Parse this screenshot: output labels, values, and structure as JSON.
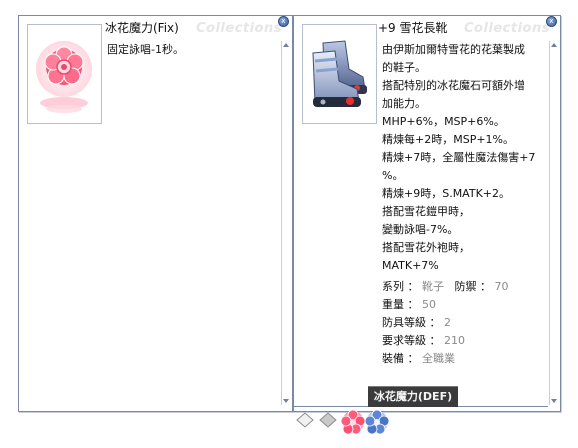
{
  "left_window": {
    "title": "冰花魔力(Fix)",
    "watermark": "Collections",
    "description": [
      "固定詠唱-1秒。"
    ]
  },
  "right_window": {
    "title": "+9 雪花長靴",
    "watermark": "Collections",
    "description": [
      "由伊斯加爾特雪花的花葉製成",
      "的鞋子。",
      "搭配特別的冰花魔石可額外增",
      "加能力。",
      "MHP+6%，MSP+6%。",
      "精煉每+2時，MSP+1%。",
      "精煉+7時，全屬性魔法傷害+7",
      "%。",
      "精煉+9時，S.MATK+2。",
      "搭配雪花鎧甲時，",
      "變動詠唱-7%。",
      "搭配雪花外袍時，",
      "MATK+7%"
    ],
    "stats": [
      {
        "label": "系列 ：",
        "value": "靴子",
        "label2": "防禦 ：",
        "value2": "70"
      },
      {
        "label": "重量 ：",
        "value": "50"
      },
      {
        "label": "防具等級 ：",
        "value": "2"
      },
      {
        "label": "要求等級 ：",
        "value": "210"
      },
      {
        "label": "裝備 ：",
        "value": "全職業"
      }
    ],
    "card_slot": "冰花魔力(DEF)"
  },
  "icons": {
    "close": "close-icon",
    "left_item": "ice-flower-card-icon",
    "right_item": "snowflake-boots-icon",
    "tray": [
      "empty-slot-icon",
      "empty-slot-icon",
      "red-flower-icon",
      "blue-flower-icon"
    ]
  }
}
